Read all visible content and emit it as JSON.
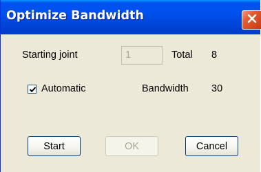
{
  "window": {
    "title": "Optimize Bandwidth",
    "close_icon": "close-icon"
  },
  "form": {
    "starting_joint_label": "Starting joint",
    "starting_joint_value": "1",
    "total_label": "Total",
    "total_value": "8",
    "automatic_label": "Automatic",
    "automatic_checked": true,
    "bandwidth_label": "Bandwidth",
    "bandwidth_value": "30"
  },
  "buttons": {
    "start": "Start",
    "ok": "OK",
    "cancel": "Cancel"
  },
  "colors": {
    "titlebar": "#0050ee",
    "dialog_bg": "#ece9d8",
    "close_button": "#e35b31",
    "disabled_text": "#aca899"
  }
}
